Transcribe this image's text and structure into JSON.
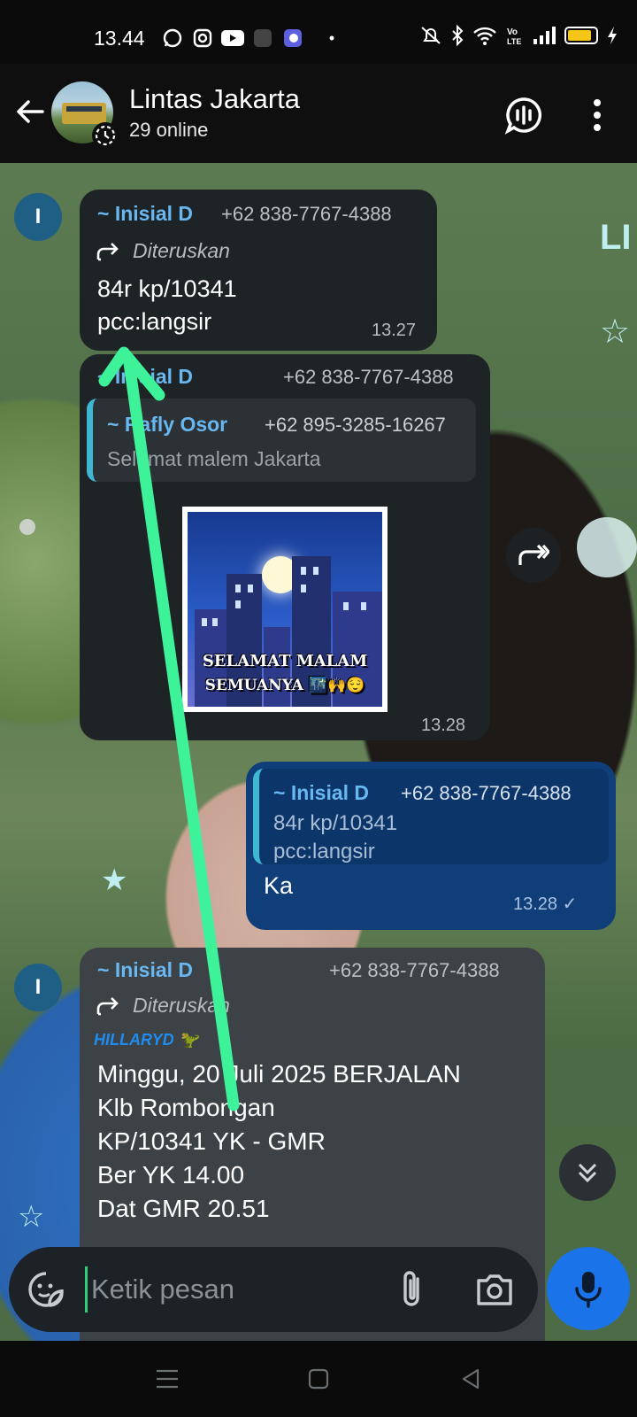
{
  "status_bar": {
    "time": "13.44",
    "battery_level": 0.85,
    "icons": [
      "whatsapp-icon",
      "instagram-icon",
      "youtube-icon",
      "app-icon",
      "app-icon",
      "dot-icon",
      "mute-icon",
      "bluetooth-icon",
      "wifi-icon",
      "volte-icon",
      "signal-icon",
      "battery-icon",
      "charging-icon"
    ]
  },
  "header": {
    "title": "Lintas Jakarta",
    "subtitle": "29 online"
  },
  "messages": [
    {
      "sender": "~ Inisial D",
      "phone": "+62 838-7767-4388",
      "forwarded_label": "Diteruskan",
      "text": "84r kp/10341\npcc:langsir",
      "time": "13.27"
    },
    {
      "sender": "~ Inisial D",
      "phone": "+62 838-7767-4388",
      "quote": {
        "sender": "~ Rafly Osor",
        "phone": "+62 895-3285-16267",
        "text": "Selamat malem Jakarta"
      },
      "sticker_text_1": "SELAMAT MALAM",
      "sticker_text_2": "SEMUANYA 🌃🙌😌",
      "time": "13.28"
    },
    {
      "quote": {
        "sender": "~ Inisial D",
        "phone": "+62 838-7767-4388",
        "text": "84r kp/10341\npcc:langsir"
      },
      "text": "Ka",
      "time": "13.28 ✓"
    },
    {
      "sender": "~ Inisial D",
      "phone": "+62 838-7767-4388",
      "forwarded_label": "Diteruskan",
      "brand_tag": "HILLARYD 🦖",
      "text": "Minggu, 20 Juli 2025 BERJALAN\nKlb Rombongan\nKP/10341 YK - GMR\nBer YK 14.00\nDat GMR 20.51"
    }
  ],
  "avatar_initial": "I",
  "background_text": "LI",
  "composer": {
    "placeholder": "Ketik pesan"
  },
  "colors": {
    "accent": "#1a73e8",
    "sender_name": "#69b7f0",
    "outgoing_bubble": "#0f3e79",
    "incoming_bubble": "#1e2326",
    "annotation_arrow": "#3ef29a"
  }
}
